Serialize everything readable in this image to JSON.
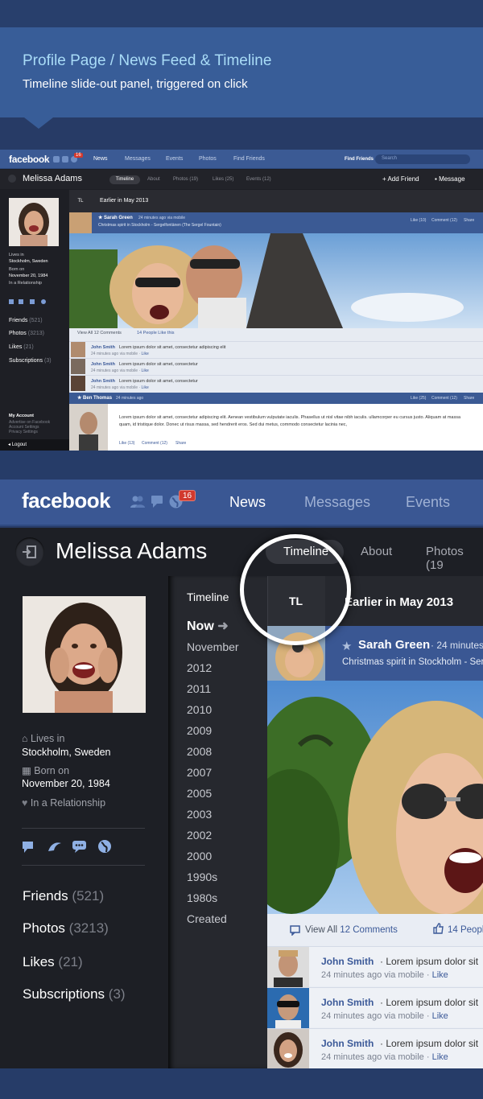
{
  "banner": {
    "title": "Profile Page / News Feed & Timeline",
    "subtitle": "Timeline slide-out panel, triggered on click"
  },
  "small": {
    "logo": "facebook",
    "badge": "16",
    "nav": [
      "News",
      "Messages",
      "Events",
      "Photos",
      "Find Friends"
    ],
    "find_friends": "Find Friends",
    "search_placeholder": "Search",
    "profile_name": "Melissa Adams",
    "tabs": [
      "Timeline",
      "About",
      "Photos (19)",
      "Likes (25)",
      "Events (12)"
    ],
    "add_friend": "Add Friend",
    "message": "Message",
    "info": [
      "Lives in",
      "Stockholm, Sweden",
      "Born on",
      "November 20, 1984",
      "In a Relationship"
    ],
    "stats": [
      {
        "label": "Friends",
        "count": "(521)"
      },
      {
        "label": "Photos",
        "count": "(3213)"
      },
      {
        "label": "Likes",
        "count": "(21)"
      },
      {
        "label": "Subscriptions",
        "count": "(3)"
      }
    ],
    "account": [
      "My Account",
      "Advertise on Facebook",
      "Account Settings",
      "Privacy Settings"
    ],
    "logout": "Logout",
    "tl": "TL",
    "earlier": "Earlier in May 2013",
    "post_author": "Sarah Green",
    "post_time": "24 minutes ago via mobile",
    "post_text": "Christmas spirit in Stockholm - Sergelfontänen (The Sergel Fountain)",
    "post_actions": [
      "Like (10)",
      "Comment (12)",
      "Share"
    ],
    "view_all": "View All 12 Comments",
    "people_like": "14 People Like this",
    "comments": [
      {
        "name": "John Smith",
        "text": "Lorem ipsum dolor sit amet, consectetur adipiscing elit",
        "meta": "24 minutes ago via mobile",
        "like": "Like"
      },
      {
        "name": "John Smith",
        "text": "Lorem ipsum dolor sit amet, consectetur",
        "meta": "24 minutes ago via mobile",
        "like": "Like"
      },
      {
        "name": "John Smith",
        "text": "Lorem ipsum dolor sit amet, consectetur",
        "meta": "24 minutes ago via mobile",
        "like": "Like"
      }
    ],
    "ben_name": "Ben Thomas",
    "ben_time": "24 minutes ago",
    "ben_actions": [
      "Like (25)",
      "Comment (12)",
      "Share"
    ],
    "ben_text": "Lorem ipsum dolor sit amet, consectetur adipiscing elit. Aenean vestibulum vulputate iaculis. Phasellus ut nisl vitae nibh iaculis. ullamcorper eu cursus justo. Aliquam at massa quam, id tristique dolor. Donec ut risus massa, sed hendrerit eros. Sed dui metus, commodo consectetur lacinia nec,",
    "ben_post_actions": [
      "Like (13)",
      "Comment (12)",
      "Share"
    ]
  },
  "big": {
    "logo": "facebook",
    "badge": "16",
    "nav": {
      "news": "News",
      "messages": "Messages",
      "events": "Events"
    },
    "profile_name": "Melissa Adams",
    "tabs": {
      "timeline": "Timeline",
      "about": "About",
      "photos": "Photos (19"
    },
    "info": {
      "lives_label": "Lives in",
      "lives_value": "Stockholm, Sweden",
      "born_label": "Born on",
      "born_value": "November 20, 1984",
      "relationship": "In a Relationship"
    },
    "stats": [
      {
        "label": "Friends",
        "count": "(521)"
      },
      {
        "label": "Photos",
        "count": "(3213)"
      },
      {
        "label": "Likes",
        "count": "(21)"
      },
      {
        "label": "Subscriptions",
        "count": "(3)"
      }
    ],
    "timeline_panel": {
      "heading": "Timeline",
      "now": "Now",
      "items": [
        "November",
        "2012",
        "2011",
        "2010",
        "2009",
        "2008",
        "2007",
        "2005",
        "2003",
        "2002",
        "2000",
        "1990s",
        "1980s",
        "Created"
      ]
    },
    "tl": "TL",
    "earlier": "Earlier in May 2013",
    "post_author": "Sarah Green",
    "post_time": "24 minutes",
    "post_text": "Christmas spirit in Stockholm - Serg",
    "view_all_prefix": "View All ",
    "view_all_count": "12 Comments",
    "people_like": "14 Peopl",
    "comments": [
      {
        "name": "John Smith",
        "text": "Lorem ipsum dolor sit",
        "meta": "24 minutes ago via mobile",
        "like": "Like"
      },
      {
        "name": "John Smith",
        "text": "Lorem ipsum dolor sit",
        "meta": "24 minutes ago via mobile",
        "like": "Like"
      },
      {
        "name": "John Smith",
        "text": "Lorem ipsum dolor sit",
        "meta": "24 minutes ago via mobile",
        "like": "Like"
      }
    ]
  },
  "colors": {
    "brand": "#3b5998",
    "badge": "#d23a2e",
    "dark": "#1d1f25"
  }
}
